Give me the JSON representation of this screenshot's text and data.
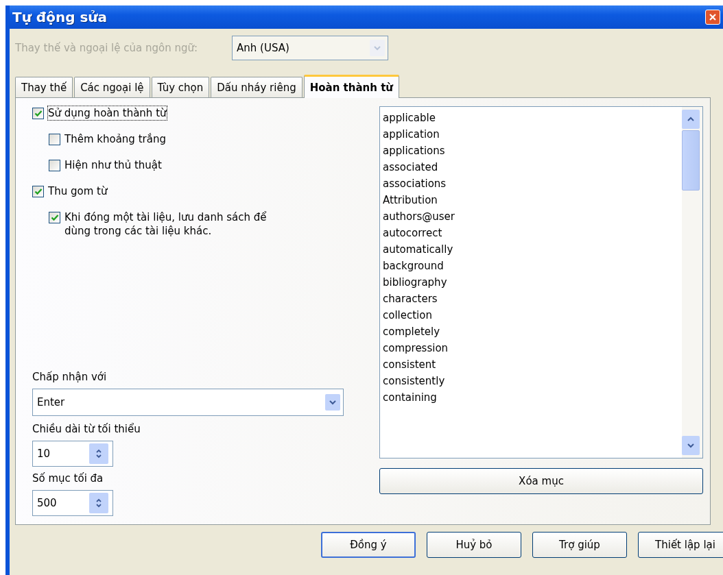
{
  "window": {
    "title": "Tự động sửa"
  },
  "language": {
    "label": "Thay thế và ngoại lệ của ngôn ngữ:",
    "value": "Anh (USA)",
    "disabled": true
  },
  "tabs": [
    {
      "label": "Thay thế",
      "selected": false
    },
    {
      "label": "Các ngoại lệ",
      "selected": false
    },
    {
      "label": "Tùy chọn",
      "selected": false
    },
    {
      "label": "Dấu nháy riêng",
      "selected": false
    },
    {
      "label": "Hoàn thành từ",
      "selected": true
    }
  ],
  "options": [
    {
      "label": "Sử dụng hoàn thành từ",
      "checked": true,
      "focused": true,
      "children": [
        {
          "label": "Thêm khoảng trắng",
          "checked": false,
          "focused": false
        },
        {
          "label": "Hiện như thủ thuật",
          "checked": false,
          "focused": false
        }
      ]
    },
    {
      "label": "Thu gom từ",
      "checked": true,
      "focused": false,
      "children": [
        {
          "label": "Khi đóng một tài liệu, lưu danh sách để dùng trong các tài liệu khác.",
          "checked": true,
          "focused": false
        }
      ]
    }
  ],
  "accept": {
    "label": "Chấp nhận với",
    "value": "Enter"
  },
  "min_length": {
    "label": "Chiều dài từ tối thiểu",
    "value": "10"
  },
  "max_entries": {
    "label": "Số mục tối đa",
    "value": "500"
  },
  "words": [
    "applicable",
    "application",
    "applications",
    "associated",
    "associations",
    "Attribution",
    "authors@user",
    "autocorrect",
    "automatically",
    "background",
    "bibliography",
    "characters",
    "collection",
    "completely",
    "compression",
    "consistent",
    "consistently",
    "containing"
  ],
  "clear_button": "Xóa mục",
  "buttons": [
    {
      "label": "Đồng ý",
      "default": true
    },
    {
      "label": "Huỷ bỏ",
      "default": false
    },
    {
      "label": "Trợ giúp",
      "default": false
    },
    {
      "label": "Thiết lập lại",
      "default": false
    }
  ]
}
